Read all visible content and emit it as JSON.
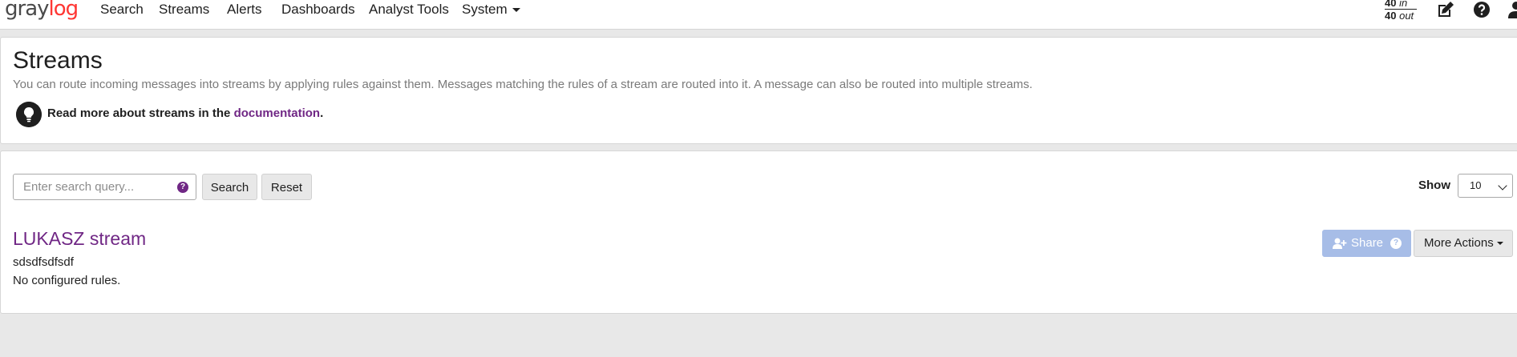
{
  "nav": {
    "logo_gray": "gray",
    "logo_log": "log",
    "items": [
      {
        "label": "Search"
      },
      {
        "label": "Streams"
      },
      {
        "label": "Alerts"
      },
      {
        "label": "Dashboards"
      },
      {
        "label": "Analyst Tools"
      },
      {
        "label": "System"
      }
    ],
    "throughput": {
      "in_value": "40",
      "in_label": "in",
      "out_value": "40",
      "out_label": "out"
    },
    "icons": [
      "edit-icon",
      "help-icon",
      "user-icon"
    ]
  },
  "header": {
    "title": "Streams",
    "description": "You can route incoming messages into streams by applying rules against them. Messages matching the rules of a stream are routed into it. A message can also be routed into multiple streams.",
    "doc_prefix": "Read more about streams in the ",
    "doc_link": "documentation",
    "doc_suffix": "."
  },
  "search": {
    "placeholder": "Enter search query...",
    "help": "?",
    "search_button": "Search",
    "reset_button": "Reset",
    "show_label": "Show",
    "page_size": "10"
  },
  "streams": [
    {
      "title": "LUKASZ stream",
      "description": "sdsdfsdfsdf",
      "rules": "No configured rules.",
      "share_label": "Share",
      "more_actions_label": "More Actions"
    }
  ],
  "colors": {
    "brand_purple": "#702785",
    "logo_red": "#ff3633",
    "share_blue": "#a7bde7"
  }
}
